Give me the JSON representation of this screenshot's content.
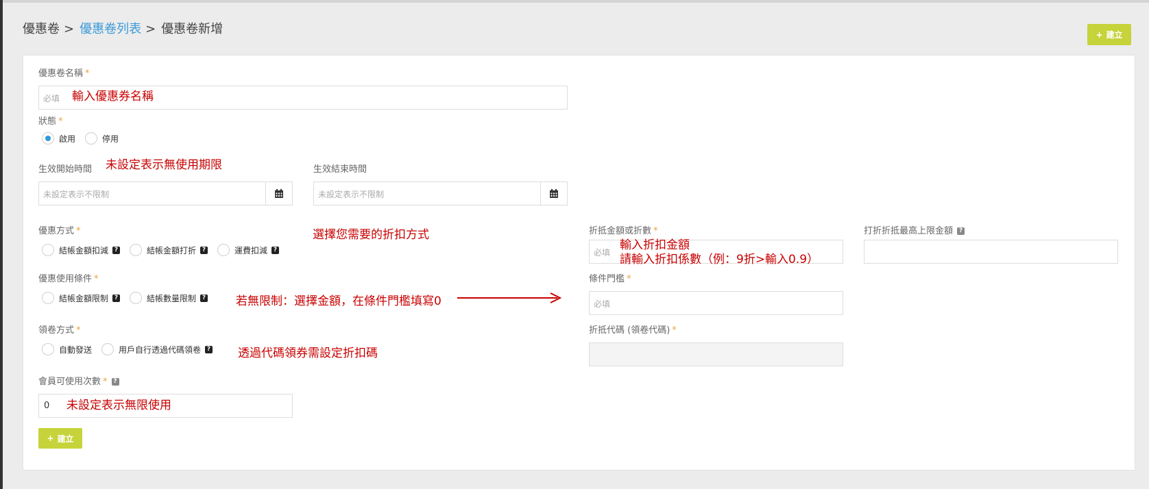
{
  "breadcrumb": {
    "root": "優惠卷",
    "list": "優惠卷列表",
    "current": "優惠卷新增",
    "separator": ">"
  },
  "buttons": {
    "create_icon": "+",
    "create_label": "建立"
  },
  "fields": {
    "name": {
      "label": "優惠卷名稱",
      "placeholder": "必填",
      "annotation": "輸入優惠券名稱"
    },
    "status": {
      "label": "狀態",
      "options": [
        "啟用",
        "停用"
      ],
      "selected": "啟用"
    },
    "start_time": {
      "label": "生效開始時間",
      "placeholder": "未設定表示不限制",
      "annotation": "未設定表示無使用期限"
    },
    "end_time": {
      "label": "生效結束時間",
      "placeholder": "未設定表示不限制"
    },
    "discount_type": {
      "label": "優惠方式",
      "options": [
        "結帳金額扣減",
        "結帳金額打折",
        "運費扣減"
      ],
      "annotation": "選擇您需要的折扣方式"
    },
    "discount_amount": {
      "label": "折抵金額或折數",
      "placeholder": "必填",
      "annotation_line1": "輸入折扣金額",
      "annotation_line2": "請輸入折扣係數（例：9折>輸入0.9）"
    },
    "max_discount": {
      "label": "打折折抵最高上限金額"
    },
    "condition": {
      "label": "優惠使用條件",
      "options": [
        "結帳金額限制",
        "結帳數量限制"
      ],
      "annotation": "若無限制：選擇金額，在條件門檻填寫0"
    },
    "threshold": {
      "label": "條件門檻",
      "placeholder": "必填"
    },
    "claim_method": {
      "label": "領卷方式",
      "options": [
        "自動發送",
        "用戶自行透過代碼領卷"
      ],
      "annotation": "透過代碼領券需設定折扣碼"
    },
    "code": {
      "label": "折抵代碼 (領卷代碼)"
    },
    "usage_count": {
      "label": "會員可使用次數",
      "value": "0",
      "annotation": "未設定表示無限使用"
    }
  },
  "symbols": {
    "required": "*",
    "help": "?"
  },
  "colors": {
    "accent_green": "#c6d33a",
    "link_blue": "#3a9ad9",
    "annotation_red": "#c80000",
    "required_orange": "#e8a33a",
    "radio_blue": "#2d9be0"
  },
  "icons": {
    "calendar": "calendar-icon",
    "help": "help-icon",
    "arrow": "arrow-right-icon"
  }
}
